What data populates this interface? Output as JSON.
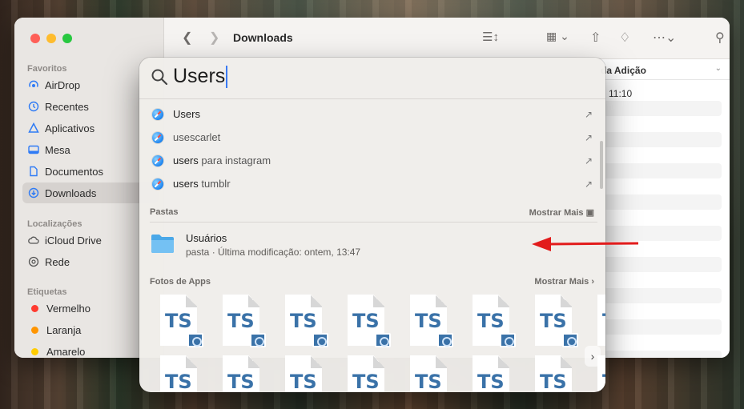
{
  "finder": {
    "title": "Downloads",
    "sidebar": {
      "sections": [
        {
          "label": "Favoritos"
        },
        {
          "label": "Localizações"
        },
        {
          "label": "Etiquetas"
        }
      ],
      "favorites": [
        {
          "label": "AirDrop",
          "icon": "airdrop-icon"
        },
        {
          "label": "Recentes",
          "icon": "clock-icon"
        },
        {
          "label": "Aplicativos",
          "icon": "apps-icon"
        },
        {
          "label": "Mesa",
          "icon": "desktop-icon"
        },
        {
          "label": "Documentos",
          "icon": "document-icon"
        },
        {
          "label": "Downloads",
          "icon": "downloads-icon",
          "selected": true
        }
      ],
      "locations": [
        {
          "label": "iCloud Drive",
          "icon": "cloud-icon"
        },
        {
          "label": "Rede",
          "icon": "network-icon"
        }
      ],
      "tags": [
        {
          "label": "Vermelho",
          "color": "#ff3b30"
        },
        {
          "label": "Laranja",
          "color": "#ff9500"
        },
        {
          "label": "Amarelo",
          "color": "#ffcc00"
        }
      ]
    },
    "column_header": "da Adição",
    "first_row_date": "11:10"
  },
  "spotlight": {
    "query": "Users",
    "suggestions": [
      {
        "bold": "Users",
        "rest": ""
      },
      {
        "bold": "",
        "rest": "usescarlet"
      },
      {
        "bold": "users",
        "rest": " para instagram"
      },
      {
        "bold": "users",
        "rest": " tumblr"
      }
    ],
    "folders_section": {
      "label": "Pastas",
      "more": "Mostrar Mais"
    },
    "folder_result": {
      "name": "Usuários",
      "meta": "pasta · Última modificação: ontem, 13:47"
    },
    "photos_section": {
      "label": "Fotos de Apps",
      "more": "Mostrar Mais"
    },
    "tile_label": "TS"
  },
  "colors": {
    "accent": "#2f7bf5",
    "annotation_arrow": "#e21b1b"
  }
}
